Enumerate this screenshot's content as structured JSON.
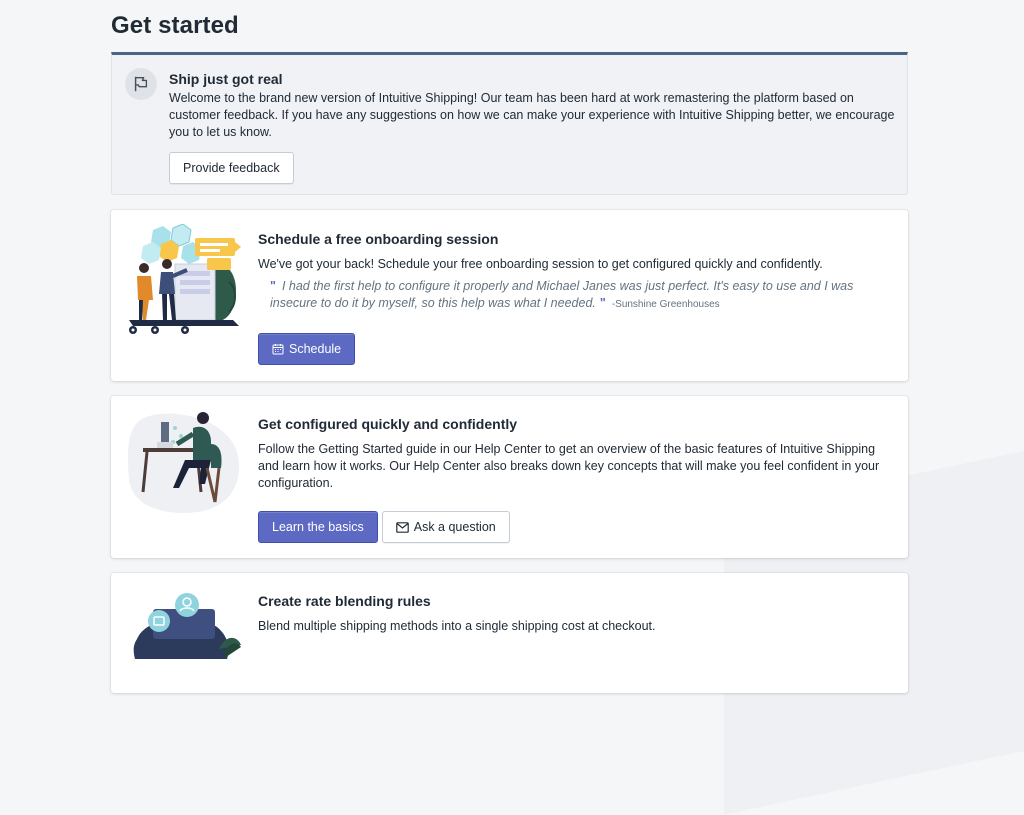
{
  "page": {
    "title": "Get started"
  },
  "banner": {
    "icon": "flag-icon",
    "title": "Ship just got real",
    "text": "Welcome to the brand new version of Intuitive Shipping! Our team has been hard at work remastering the platform based on customer feedback. If you have any suggestions on how we can make your experience with Intuitive Shipping better, we encourage you to let us know.",
    "button": "Provide feedback"
  },
  "cards": [
    {
      "title": "Schedule a free onboarding session",
      "description": "We've got your back! Schedule your free onboarding session to get configured quickly and confidently.",
      "quote": "I had the first help to configure it properly and Michael Janes was just perfect. It's easy to use and I was insecure to do it by myself, so this help was what I needed.",
      "quote_open": "\"",
      "quote_close": "\"",
      "quote_author": "-Sunshine Greenhouses",
      "button": "Schedule",
      "button_icon": "calendar-icon"
    },
    {
      "title": "Get configured quickly and confidently",
      "description": "Follow the Getting Started guide in our Help Center to get an overview of the basic features of Intuitive Shipping and learn how it works. Our Help Center also breaks down key concepts that will make you feel confident in your configuration.",
      "primary_button": "Learn the basics",
      "secondary_button": "Ask a question",
      "secondary_icon": "envelope-icon"
    },
    {
      "title": "Create rate blending rules",
      "description": "Blend multiple shipping methods into a single shipping cost at checkout."
    }
  ],
  "colors": {
    "primary": "#5c6ac4",
    "banner_accent": "#47668a",
    "text": "#212b36",
    "muted": "#637381"
  }
}
